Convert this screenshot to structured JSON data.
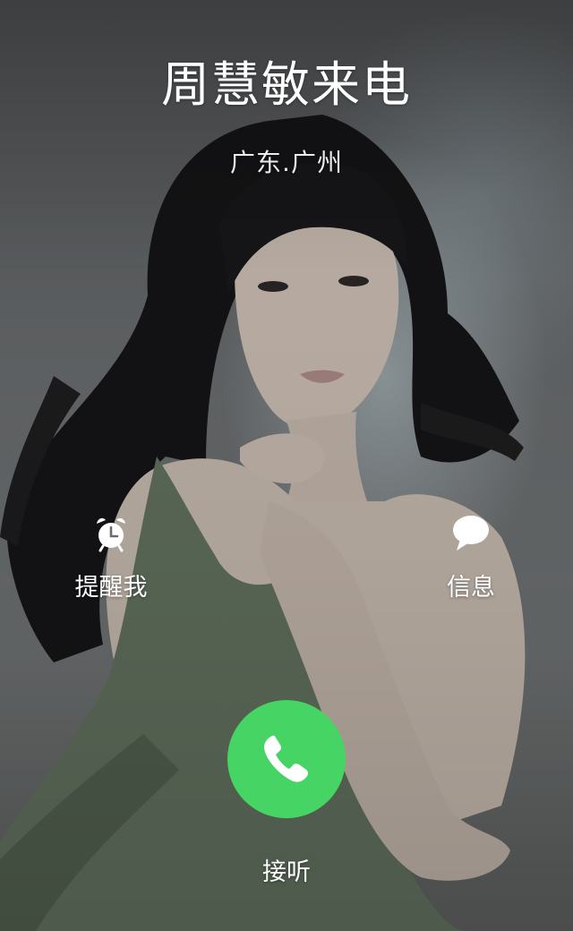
{
  "call": {
    "caller_name": "周慧敏来电",
    "location": "广东.广州"
  },
  "actions": {
    "remind": {
      "label": "提醒我",
      "icon": "alarm-clock-icon"
    },
    "message": {
      "label": "信息",
      "icon": "speech-bubble-icon"
    },
    "answer": {
      "label": "接听",
      "icon": "phone-handset-icon"
    }
  },
  "colors": {
    "answer_button": "#46d464",
    "text": "#ffffff"
  }
}
